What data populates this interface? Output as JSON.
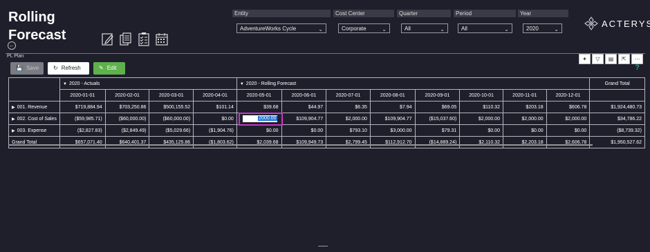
{
  "app": {
    "title_line1": "Rolling",
    "title_line2": "Forecast",
    "logo": "ACTERYS"
  },
  "filters": [
    {
      "label": "Entity",
      "value": "AdventureWorks Cycle"
    },
    {
      "label": "Cost Center",
      "value": "Corporate"
    },
    {
      "label": "Quarter",
      "value": "All"
    },
    {
      "label": "Period",
      "value": "All"
    },
    {
      "label": "Year",
      "value": "2020"
    }
  ],
  "panel": {
    "title": "PL Plan",
    "help": "?"
  },
  "toolbar": {
    "save": "Save",
    "refresh": "Refresh",
    "edit": "Edit"
  },
  "grid": {
    "group_actuals": "2020 - Actuals",
    "group_forecast": "2020 - Rolling Forecast",
    "grand_total_header": "Grand Total",
    "periods": [
      "2020-01-01",
      "2020-02-01",
      "2020-03-01",
      "2020-04-01",
      "2020-05-01",
      "2020-06-01",
      "2020-07-01",
      "2020-08-01",
      "2020-09-01",
      "2020-10-01",
      "2020-11-01",
      "2020-12-01"
    ],
    "rows": [
      {
        "label": "001. Revenue",
        "values": [
          "$719,884.94",
          "$703,250.86",
          "$500,155.52",
          "$101.14",
          "$39.68",
          "$44.97",
          "$6.35",
          "$7.94",
          "$69.05",
          "$110.32",
          "$203.18",
          "$606.78"
        ],
        "total": "$1,924,480.73"
      },
      {
        "label": "002. Cost of Sales",
        "values": [
          "($59,985.71)",
          "($60,000.00)",
          "($60,000.00)",
          "$0.00",
          "2000.00",
          "$109,904.77",
          "$2,000.00",
          "$109,904.77",
          "($15,037.60)",
          "$2,000.00",
          "$2,000.00",
          "$2,000.00"
        ],
        "total": "$34,786.22"
      },
      {
        "label": "003. Expense",
        "values": [
          "($2,827.83)",
          "($2,849.49)",
          "($5,029.66)",
          "($1,904.76)",
          "$0.00",
          "$0.00",
          "$793.10",
          "$3,000.00",
          "$79.31",
          "$0.00",
          "$0.00",
          "$0.00"
        ],
        "total": "($8,739.32)"
      },
      {
        "label": "Grand Total",
        "values": [
          "$657,071.40",
          "$640,401.37",
          "$435,125.86",
          "($1,803.62)",
          "$2,039.68",
          "$109,949.73",
          "$2,799.45",
          "$112,912.70",
          "($14,889.24)",
          "$2,110.32",
          "$2,203.18",
          "$2,606.78"
        ],
        "total": "$1,950,527.62"
      }
    ]
  }
}
